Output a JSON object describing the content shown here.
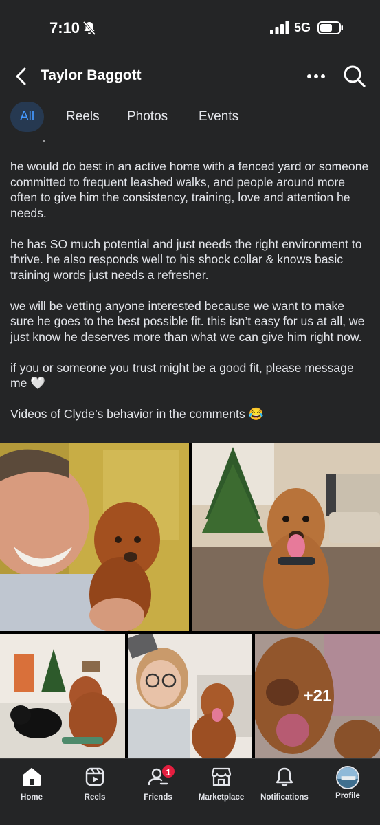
{
  "status_bar": {
    "time": "7:10",
    "network": "5G"
  },
  "header": {
    "title": "Taylor Baggott"
  },
  "tabs": [
    {
      "label": "All",
      "active": true
    },
    {
      "label": "Reels",
      "active": false
    },
    {
      "label": "Photos",
      "active": false
    },
    {
      "label": "Events",
      "active": false
    }
  ],
  "post": {
    "paragraphs": [
      "he would do best in an active home with a fenced yard or someone committed to frequent leashed walks, and people around more often to give him the consistency, training, love and attention he needs.",
      "he has SO much potential and just needs the right environment to thrive. he also responds well to his shock collar & knows basic training words just needs a refresher.",
      "we will be vetting anyone interested because we want to make sure he goes to the best possible fit. this isn’t easy for us at all, we just know he deserves more than what we can give him right now.",
      "if you or someone you trust might be a good fit, please message me 🤍",
      "Videos of Clyde’s behavior in the comments 😂"
    ]
  },
  "photos": {
    "more_count": "+21"
  },
  "bottom_nav": [
    {
      "label": "Home",
      "icon": "home-icon",
      "active": true
    },
    {
      "label": "Reels",
      "icon": "reels-icon"
    },
    {
      "label": "Friends",
      "icon": "friends-icon",
      "badge": "1"
    },
    {
      "label": "Marketplace",
      "icon": "marketplace-icon"
    },
    {
      "label": "Notifications",
      "icon": "bell-icon"
    },
    {
      "label": "Profile",
      "icon": "profile-avatar"
    }
  ],
  "colors": {
    "background": "#242526",
    "accent": "#4599ff",
    "active_tab_bg": "#263951",
    "badge": "#e41e3f"
  }
}
